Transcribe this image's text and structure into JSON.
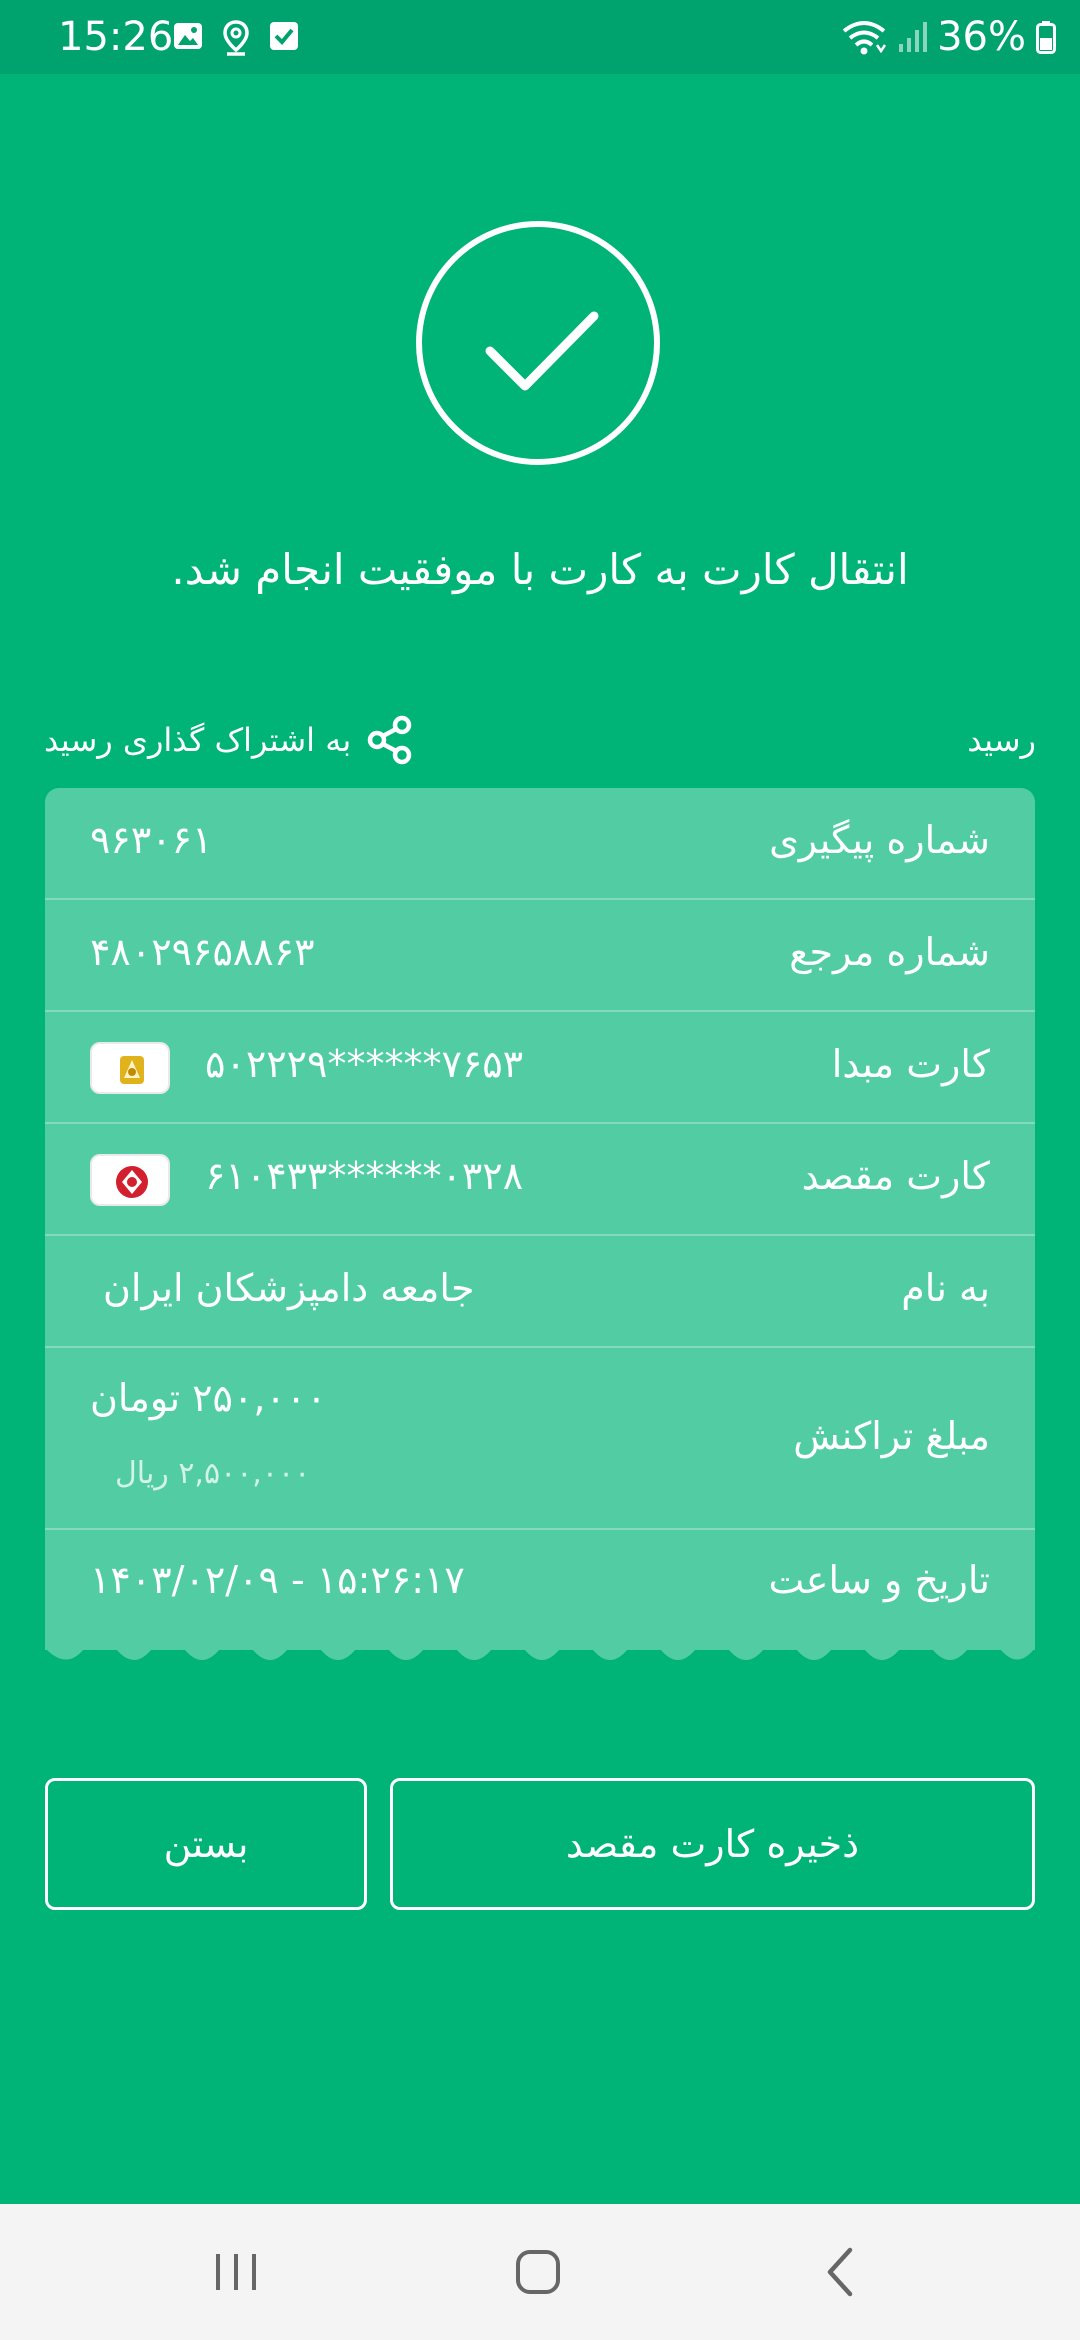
{
  "status_bar": {
    "time": "15:26",
    "battery": "36%",
    "icons": [
      "gallery-icon",
      "location-icon",
      "checkbox-icon",
      "wifi-icon",
      "signal-icon",
      "battery-icon"
    ]
  },
  "success": {
    "icon": "checkmark-circle-icon",
    "title": "انتقال کارت به کارت با موفقیت انجام شد."
  },
  "receipt": {
    "label": "رسید",
    "share_label": "به اشتراک گذاری رسید",
    "rows": [
      {
        "label": "شماره پیگیری",
        "value": "۹۶۳۰۶۱"
      },
      {
        "label": "شماره مرجع",
        "value": "۴۸۰۲۹۶۵۸۸۶۳"
      },
      {
        "label": "کارت مبدا",
        "value": "۵۰۲۲۲۹******۷۶۵۳",
        "bank_icon": "bank-logo-gold"
      },
      {
        "label": "کارت مقصد",
        "value": "۶۱۰۴۳۳******۰۳۲۸",
        "bank_icon": "bank-logo-red"
      },
      {
        "label": "به نام",
        "value": "جامعه دامپزشکان ایران"
      },
      {
        "label": "مبلغ تراکنش",
        "value": "۲۵۰,۰۰۰ تومان",
        "sub_value": "۲,۵۰۰,۰۰۰ ریال"
      },
      {
        "label": "تاریخ و ساعت",
        "value": "۱۴۰۳/۰۲/۰۹ - ۱۵:۲۶:۱۷"
      }
    ]
  },
  "buttons": {
    "save_label": "ذخیره کارت مقصد",
    "close_label": "بستن"
  },
  "colors": {
    "background": "#00b377",
    "card": "#52cda3",
    "status_bar": "#00a36d"
  }
}
